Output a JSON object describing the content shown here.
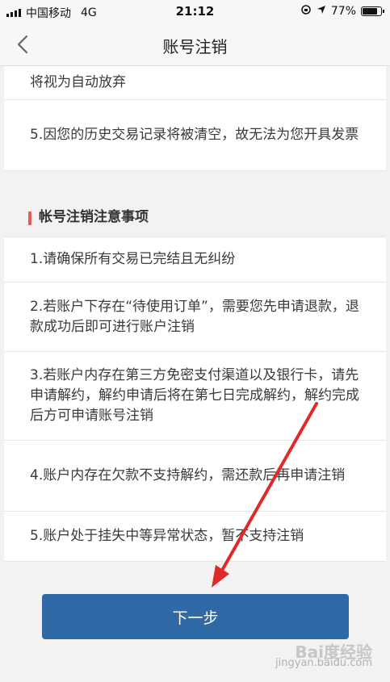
{
  "status_bar": {
    "carrier": "中国移动",
    "network": "4G",
    "time": "21:12",
    "battery": "77%",
    "battery_level": 0.77
  },
  "nav": {
    "title": "账号注销",
    "back_icon": "chevron-left-icon"
  },
  "top_items": [
    "将视为自动放弃",
    "5.因您的历史交易记录将被清空，故无法为您开具发票"
  ],
  "section": {
    "title": "帐号注销注意事项",
    "accent_color": "#e55a5a",
    "items": [
      "1.请确保所有交易已完结且无纠纷",
      "2.若账户下存在“待使用订单”，需要您先申请退款，退款成功后即可进行账户注销",
      "3.若账户内存在第三方免密支付渠道以及银行卡，请先申请解约，解约申请后将在第七日完成解约，解约完成后方可申请账号注销",
      "4.账户内存在欠款不支持解约，需还款后再申请注销",
      "5.账户处于挂失中等异常状态，暂不支持注销"
    ]
  },
  "primary_button": {
    "label": "下一步",
    "color": "#2f6aa7"
  },
  "annotation_arrow_color": "#e02a2a",
  "watermark": {
    "brand": "Bai度经验",
    "sub": "jingyan.baidu.com"
  }
}
